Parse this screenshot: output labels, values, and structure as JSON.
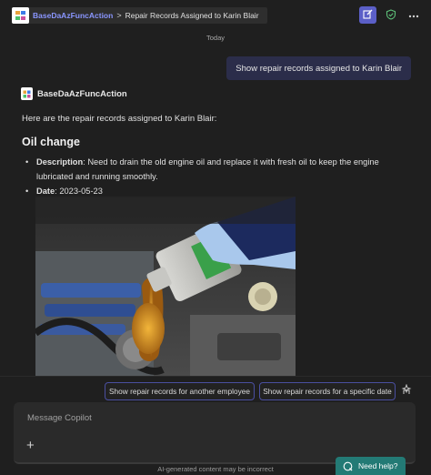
{
  "header": {
    "app_name": "BaseDaAzFuncAction",
    "separator": ">",
    "page_title": "Repair Records Assigned to Karin Blair"
  },
  "chat": {
    "date_divider": "Today",
    "user_message": "Show repair records assigned to Karin Blair",
    "bot_name": "BaseDaAzFuncAction",
    "intro": "Here are the repair records assigned to Karin Blair:",
    "record": {
      "title": "Oil change",
      "description_label": "Description",
      "description": ": Need to drain the old engine oil and replace it with fresh oil to keep the engine lubricated and running smoothly.",
      "date_label": "Date",
      "date": ": 2023-05-23"
    }
  },
  "suggestions": [
    "Show repair records for another employee",
    "Show repair records for a specific date"
  ],
  "composer": {
    "placeholder": "Message Copilot",
    "disclaimer": "AI-generated content may be incorrect"
  },
  "help_button": "Need help?",
  "colors": {
    "background": "#1f1f1f",
    "accent": "#5b5fc7",
    "link": "#8a96ff",
    "user_bubble": "#2b2d4a",
    "help": "#237a75"
  },
  "icons": [
    "app-logo-icon",
    "edit-icon",
    "shield-check-icon",
    "more-icon",
    "bot-logo-icon",
    "compose-suggestions-icon",
    "plus-icon",
    "help-icon"
  ]
}
